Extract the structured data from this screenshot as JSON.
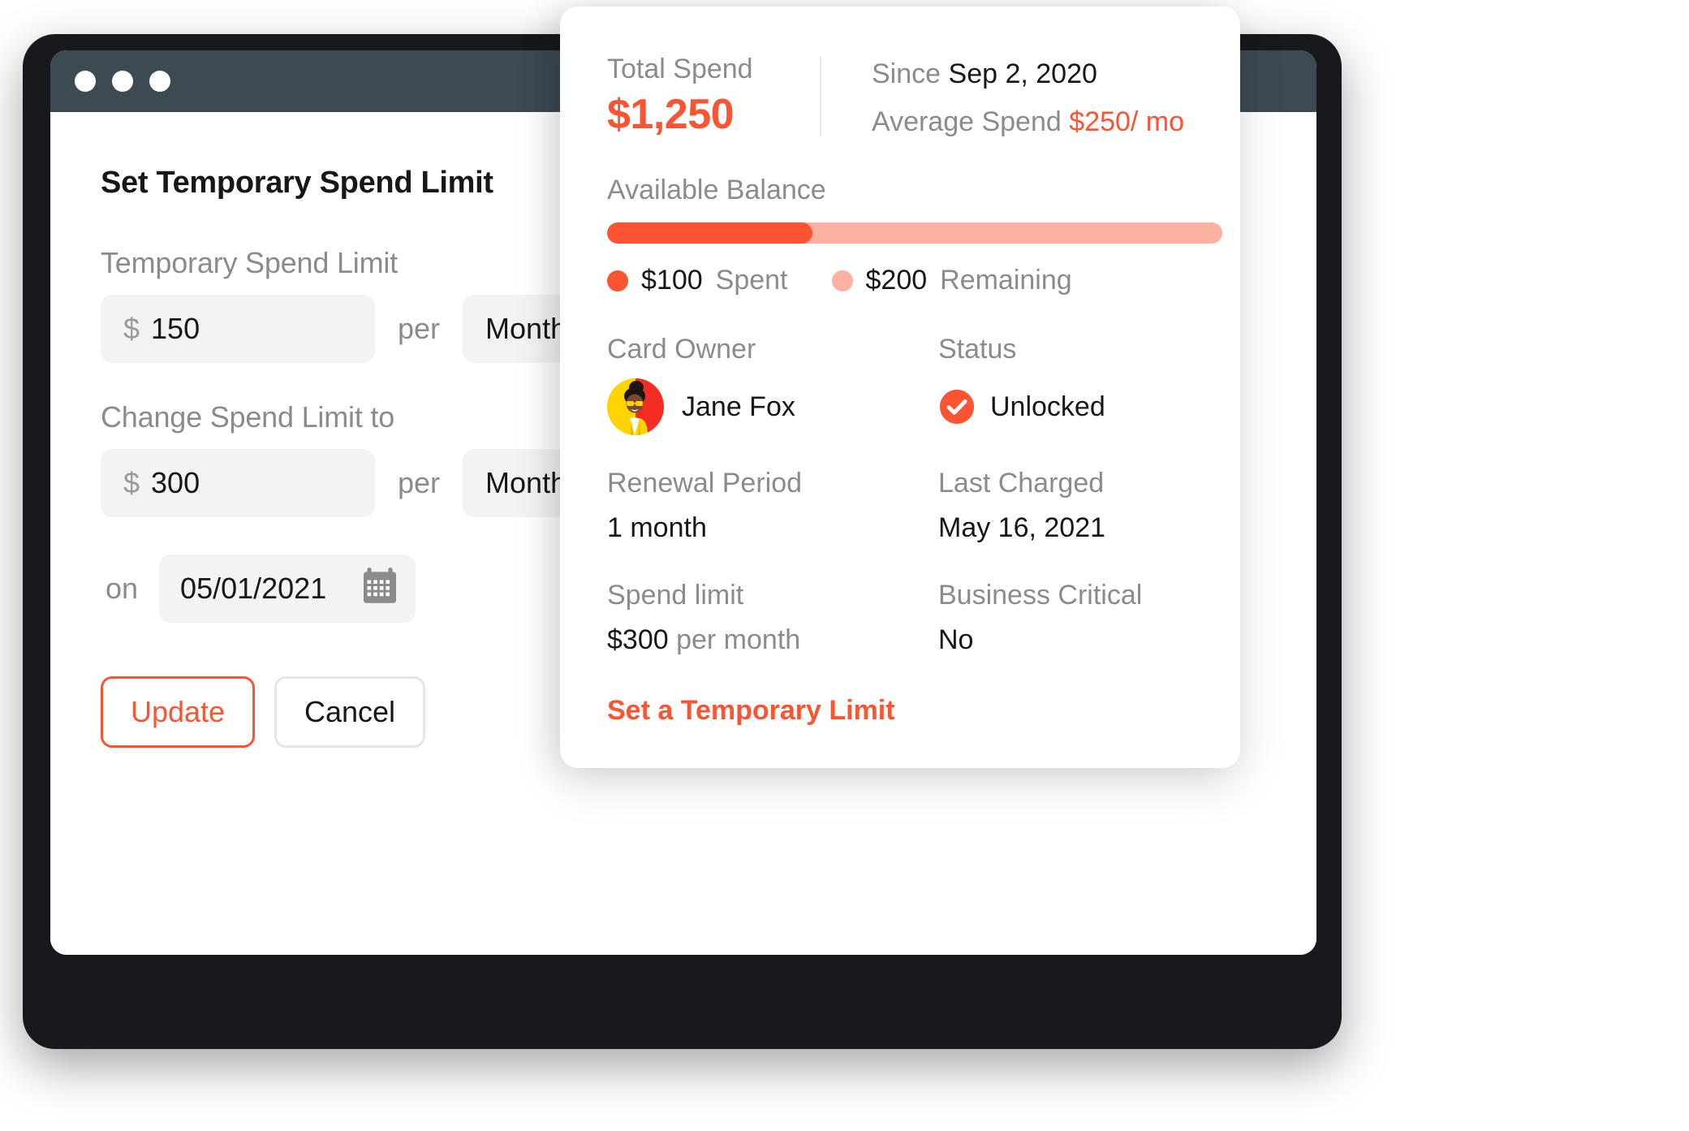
{
  "window": {
    "traffic_lights": [
      "close",
      "minimize",
      "zoom"
    ]
  },
  "form": {
    "title": "Set Temporary Spend Limit",
    "temp_limit_label": "Temporary Spend Limit",
    "temp_limit_currency": "$",
    "temp_limit_value": "150",
    "temp_limit_per": "per",
    "temp_limit_period": "Month",
    "change_limit_label": "Change Spend Limit to",
    "change_limit_currency": "$",
    "change_limit_value": "300",
    "change_limit_per": "per",
    "change_limit_period": "Month",
    "date_prefix": "on",
    "date_value": "05/01/2021",
    "update_label": "Update",
    "cancel_label": "Cancel"
  },
  "detail": {
    "total_spend_label": "Total Spend",
    "total_spend_value": "$1,250",
    "since_label": "Since",
    "since_date": "Sep 2, 2020",
    "average_label": "Average Spend",
    "average_value": "$250/ mo",
    "balance_label": "Available Balance",
    "spent_amount": "$100",
    "spent_word": "Spent",
    "remaining_amount": "$200",
    "remaining_word": "Remaining",
    "card_owner_label": "Card Owner",
    "card_owner_name": "Jane Fox",
    "status_label": "Status",
    "status_value": "Unlocked",
    "renewal_label": "Renewal Period",
    "renewal_value": "1 month",
    "last_charged_label": "Last Charged",
    "last_charged_value": "May 16, 2021",
    "spend_limit_label": "Spend limit",
    "spend_limit_amount": "$300",
    "spend_limit_unit": "per month",
    "business_critical_label": "Business Critical",
    "business_critical_value": "No",
    "temp_limit_link": "Set a Temporary Limit"
  },
  "chart_data": {
    "type": "bar",
    "title": "Available Balance",
    "categories": [
      "Spent",
      "Remaining"
    ],
    "values": [
      100,
      200
    ],
    "colors": [
      "#fb5433",
      "#fdb2a1"
    ],
    "total": 300,
    "spent_pct": 33,
    "remaining_pct": 67,
    "orientation": "horizontal-stacked",
    "legend": "bottom",
    "xlabel": "",
    "ylabel": ""
  },
  "colors": {
    "accent": "#fb5433",
    "accent_light": "#fdb2a1",
    "muted_text": "#8b8b8d",
    "dark_text": "#15171a",
    "titlebar": "#3c4a52",
    "field_bg": "#f3f3f3",
    "device_bezel": "#17191c"
  }
}
